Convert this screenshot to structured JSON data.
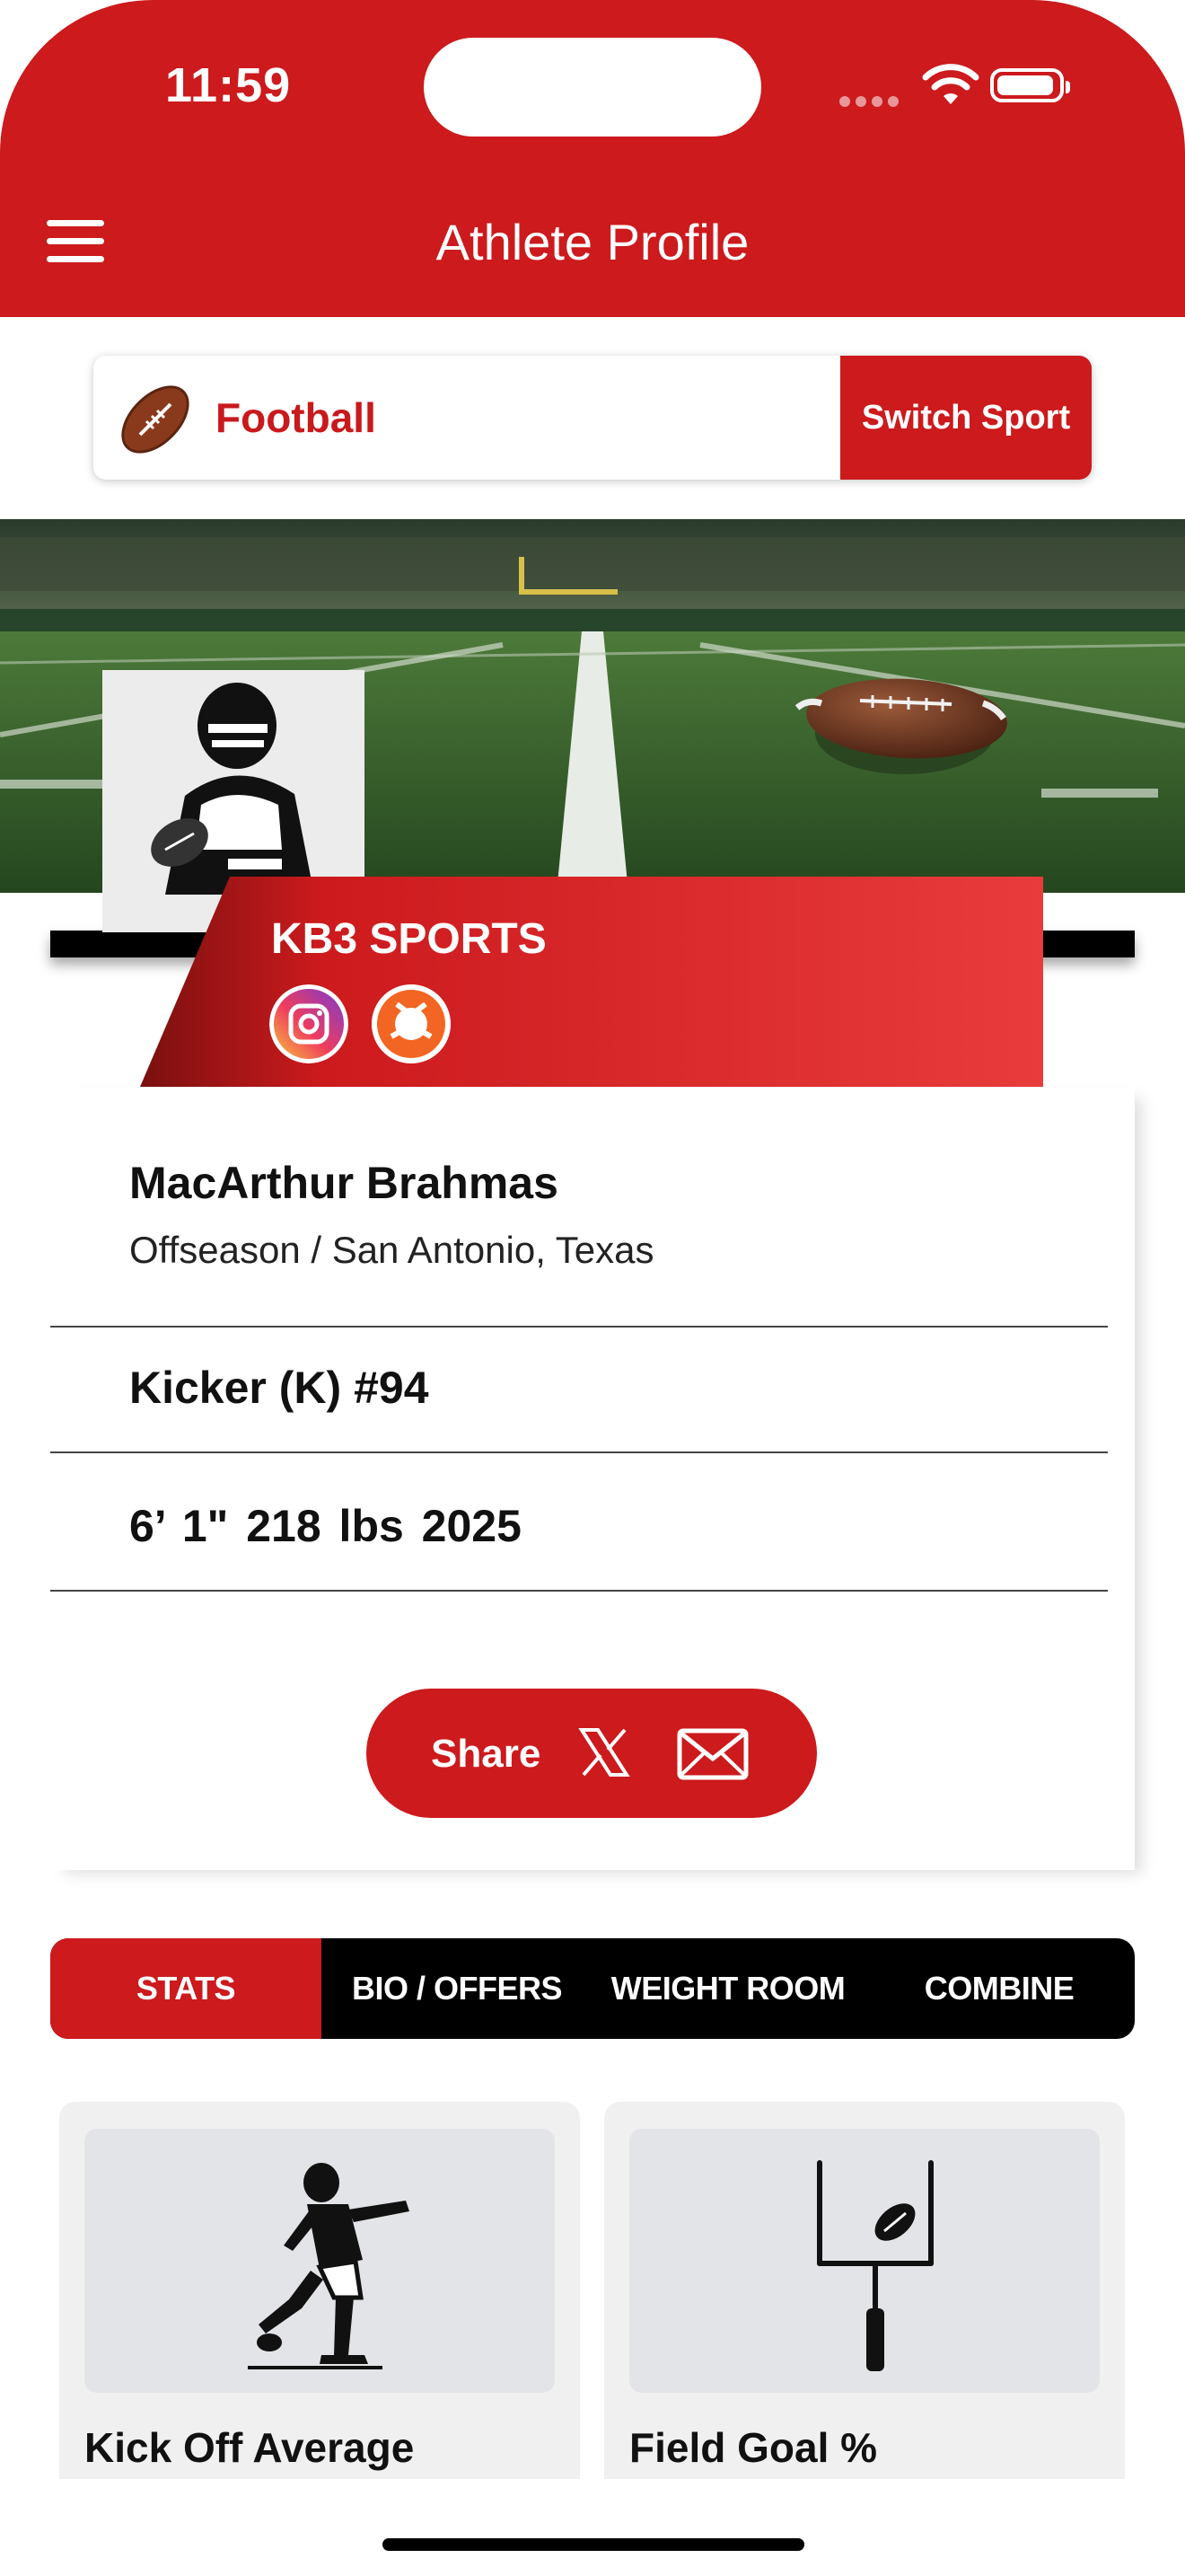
{
  "status_bar": {
    "time": "11:59"
  },
  "header": {
    "title": "Athlete Profile",
    "menu_icon": "hamburger-menu-icon"
  },
  "sport_selector": {
    "sport": "Football",
    "switch_label": "Switch Sport",
    "icon": "football-icon"
  },
  "banner": {
    "scene": "football-field-image",
    "avatar": "football-player-avatar"
  },
  "team": {
    "name": "KB3 SPORTS",
    "social_icons": [
      "instagram-icon",
      "orange-circle-logo-icon"
    ]
  },
  "athlete": {
    "name": "MacArthur Brahmas",
    "subtitle": "Offseason / San Antonio, Texas",
    "position": "Kicker (K) #94",
    "measurements": "6’ 1\"  218 lbs  2025"
  },
  "share": {
    "label": "Share",
    "icons": [
      "x-icon",
      "mail-icon"
    ]
  },
  "tabs": [
    {
      "label": "STATS",
      "active": true
    },
    {
      "label": "BIO / OFFERS",
      "active": false
    },
    {
      "label": "WEIGHT ROOM",
      "active": false
    },
    {
      "label": "COMBINE",
      "active": false
    }
  ],
  "stats": [
    {
      "label": "Kick Off Average",
      "icon": "kicker-icon"
    },
    {
      "label": "Field Goal %",
      "icon": "goal-post-icon"
    }
  ],
  "colors": {
    "brand_red": "#cc1a1d",
    "tab_bar": "#000000",
    "card_bg": "#f0f0f1"
  }
}
